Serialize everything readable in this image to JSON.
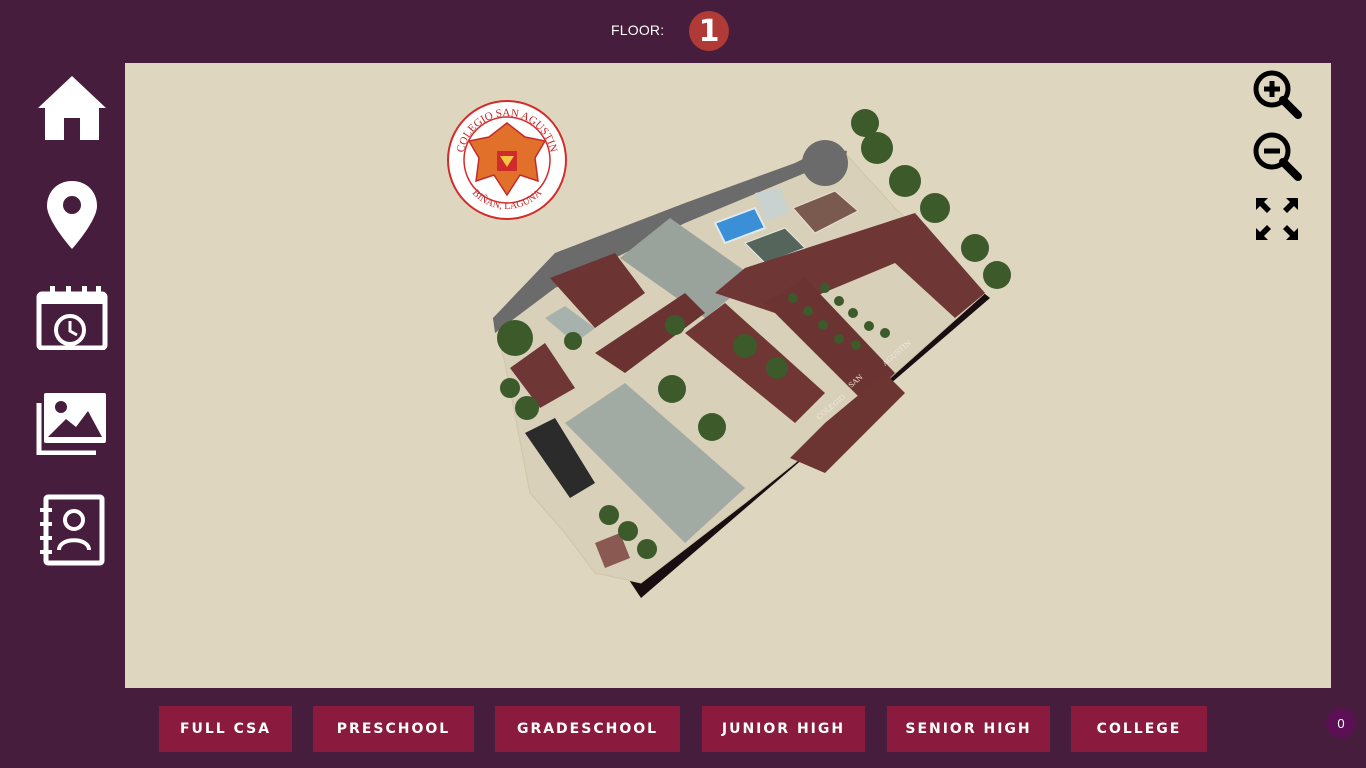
{
  "floor": {
    "label": "FLOOR:",
    "current": "1"
  },
  "sidebar": {
    "items": [
      {
        "icon": "home-icon"
      },
      {
        "icon": "map-pin-icon"
      },
      {
        "icon": "calendar-clock-icon"
      },
      {
        "icon": "gallery-icon"
      },
      {
        "icon": "contacts-icon"
      }
    ]
  },
  "map": {
    "logo": {
      "top_text": "COLEGIO SAN AGUSTIN",
      "bottom_text": "BIÑAN, LAGUNA"
    },
    "building_label": [
      "COLEGIO",
      "SAN",
      "AGUSTIN"
    ],
    "controls": {
      "zoom_in": "zoom-in-icon",
      "zoom_out": "zoom-out-icon",
      "fullscreen": "expand-icon"
    }
  },
  "categories": [
    "FULL CSA",
    "PRESCHOOL",
    "GRADESCHOOL",
    "JUNIOR HIGH",
    "SENIOR HIGH",
    "COLLEGE"
  ],
  "counter": "0",
  "colors": {
    "background": "#461d3c",
    "map": "#ded6be",
    "button": "#8a1b3e",
    "badge": "#b03a35"
  }
}
